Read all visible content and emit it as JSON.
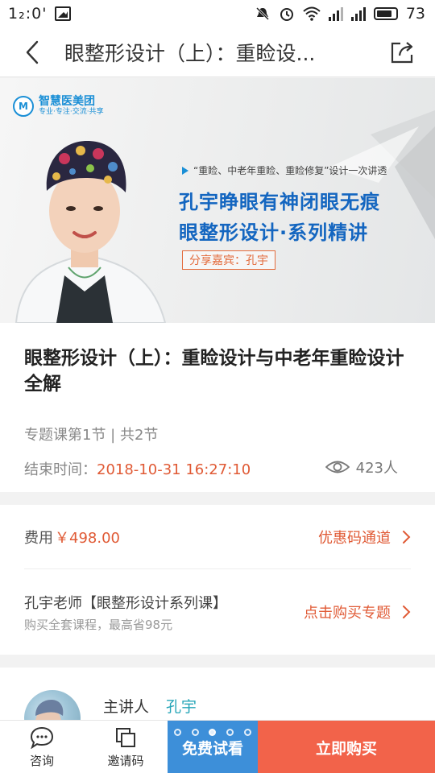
{
  "status_bar": {
    "time": "1₂:0'",
    "battery": "73",
    "icons": [
      "notification-icon",
      "mute-icon",
      "alarm-icon",
      "wifi-icon",
      "signal-icon",
      "signal-icon",
      "battery-icon"
    ]
  },
  "nav": {
    "title": "眼整形设计（上）：重睑设...",
    "back_icon": "chevron-left-icon",
    "share_icon": "share-icon"
  },
  "banner": {
    "brand_name": "智慧医美团",
    "brand_slogan": "专业·专注·交流·共享",
    "tagline": "“重睑、中老年重睑、重睑修复”设计一次讲透",
    "headline_1": "孔宇睁眼有神闭眼无痕",
    "headline_2": "眼整形设计·系列精讲",
    "guest": "分享嘉宾：孔宇"
  },
  "course": {
    "title": "眼整形设计（上）：重睑设计与中老年重睑设计全解",
    "meta": "专题课第1节 | 共2节",
    "end_label": "结束时间：",
    "end_value": "2018-10-31 16:27:10",
    "views": "423人"
  },
  "pricing": {
    "fee_label": "费用",
    "fee_value": "￥498.00",
    "coupon_link": "优惠码通道",
    "bundle_title": "孔宇老师【眼整形设计系列课】",
    "bundle_sub": "购买全套课程，最高省98元",
    "bundle_link": "点击购买专题"
  },
  "presenter": {
    "label": "主讲人",
    "name": "孔宇"
  },
  "bottom_bar": {
    "consult": "咨询",
    "invite": "邀请码",
    "trial": "免费试看",
    "buy": "立即购买"
  },
  "colors": {
    "accent_orange": "#e05a35",
    "trial_blue": "#3d8fd9",
    "buy_red": "#f2634a",
    "presenter_teal": "#27a6b8",
    "banner_blue": "#1466c0"
  }
}
